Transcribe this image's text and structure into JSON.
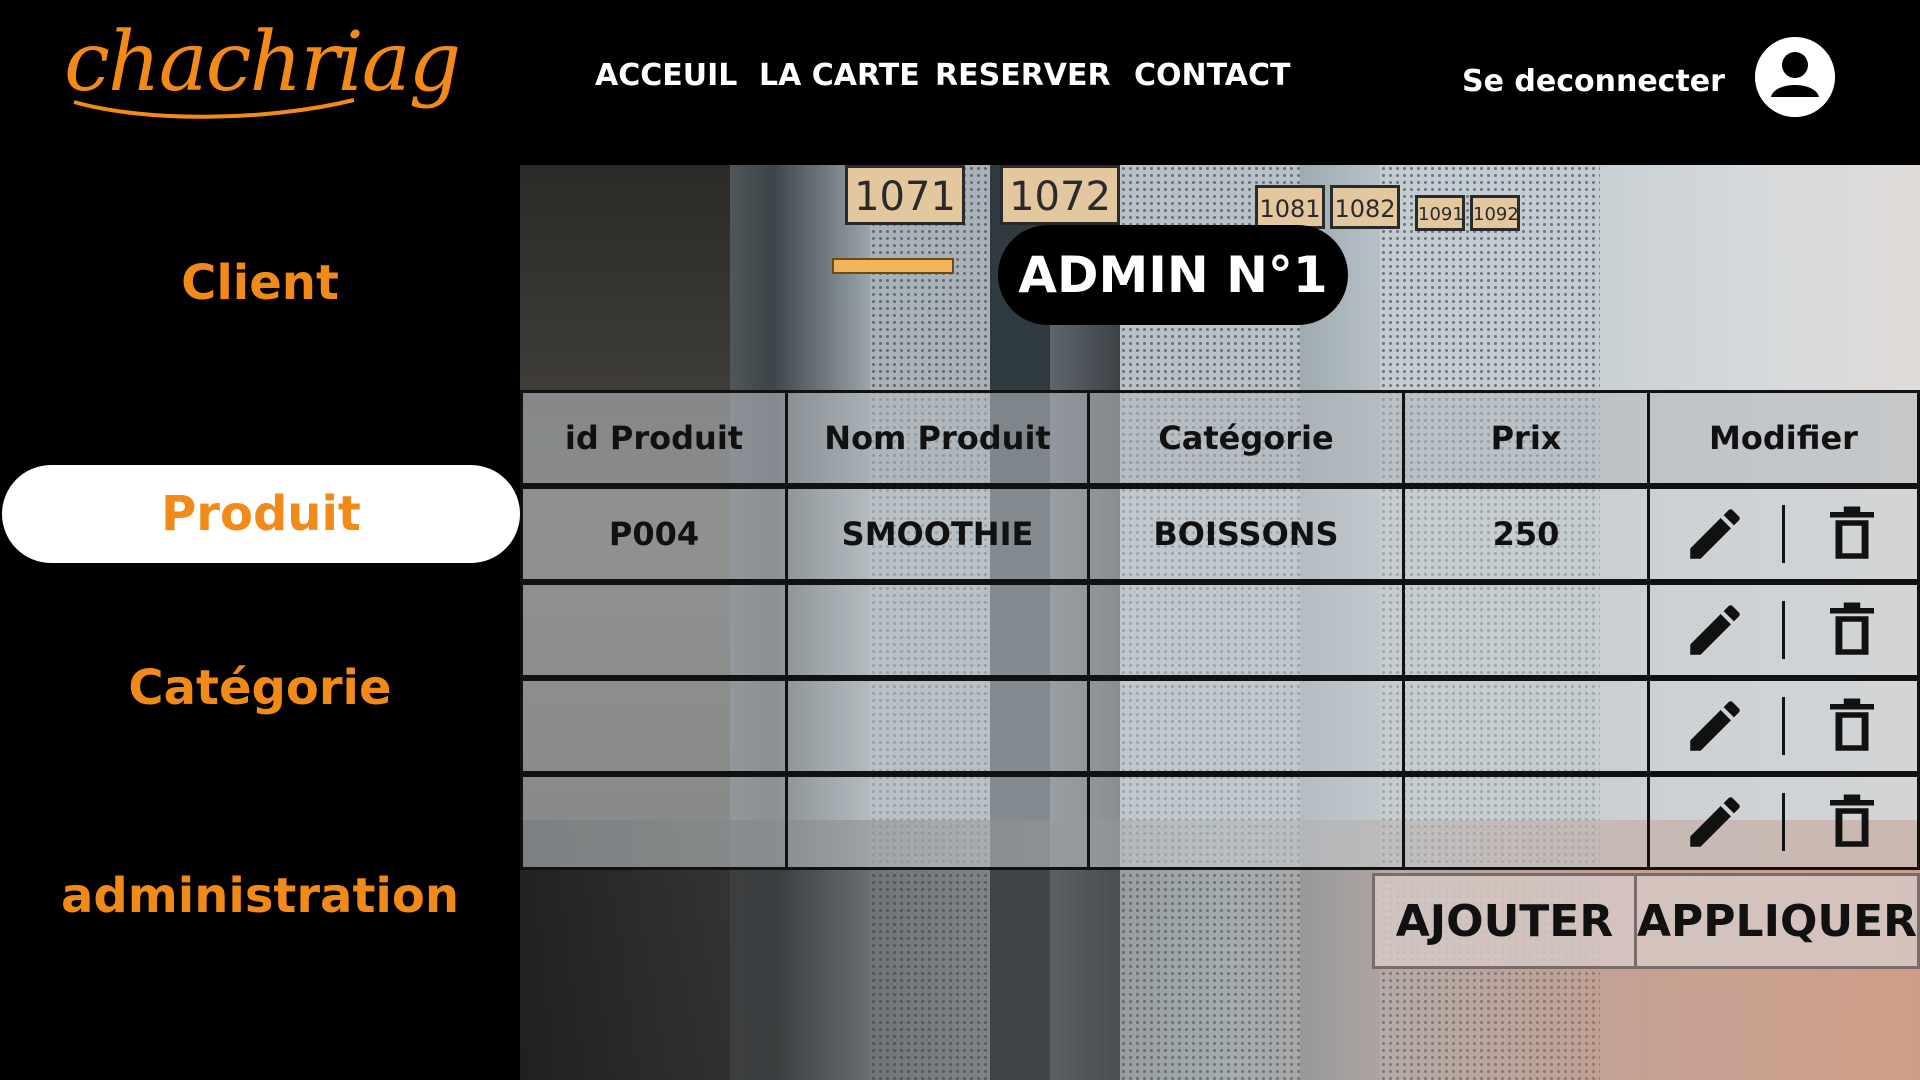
{
  "brand": {
    "logo_text": "chachriag"
  },
  "nav": {
    "items": [
      {
        "label": "ACCEUIL"
      },
      {
        "label": "LA CARTE"
      },
      {
        "label": "RESERVER"
      },
      {
        "label": "CONTACT"
      }
    ],
    "logout_label": "Se deconnecter",
    "avatar_icon": "user-circle-icon"
  },
  "sidebar": {
    "items": [
      {
        "label": "Client"
      },
      {
        "label": "Produit",
        "active": true
      },
      {
        "label": "Catégorie"
      },
      {
        "label": "administration"
      }
    ]
  },
  "page": {
    "title": "ADMIN N°1"
  },
  "background": {
    "plates": [
      "1071",
      "1072",
      "1081",
      "1082",
      "1091",
      "1092"
    ]
  },
  "table": {
    "headers": [
      "id Produit",
      "Nom Produit",
      "Catégorie",
      "Prix",
      "Modifier"
    ],
    "rows": [
      {
        "id": "P004",
        "name": "SMOOTHIE",
        "category": "BOISSONS",
        "price": "250"
      },
      {
        "id": "",
        "name": "",
        "category": "",
        "price": ""
      },
      {
        "id": "",
        "name": "",
        "category": "",
        "price": ""
      },
      {
        "id": "",
        "name": "",
        "category": "",
        "price": ""
      }
    ],
    "edit_icon": "pencil-icon",
    "delete_icon": "trash-icon"
  },
  "actions": {
    "add_label": "AJOUTER",
    "apply_label": "APPLIQUER"
  },
  "colors": {
    "accent": "#f28a1a",
    "header_bg": "#000000",
    "active_bg": "#ffffff"
  }
}
